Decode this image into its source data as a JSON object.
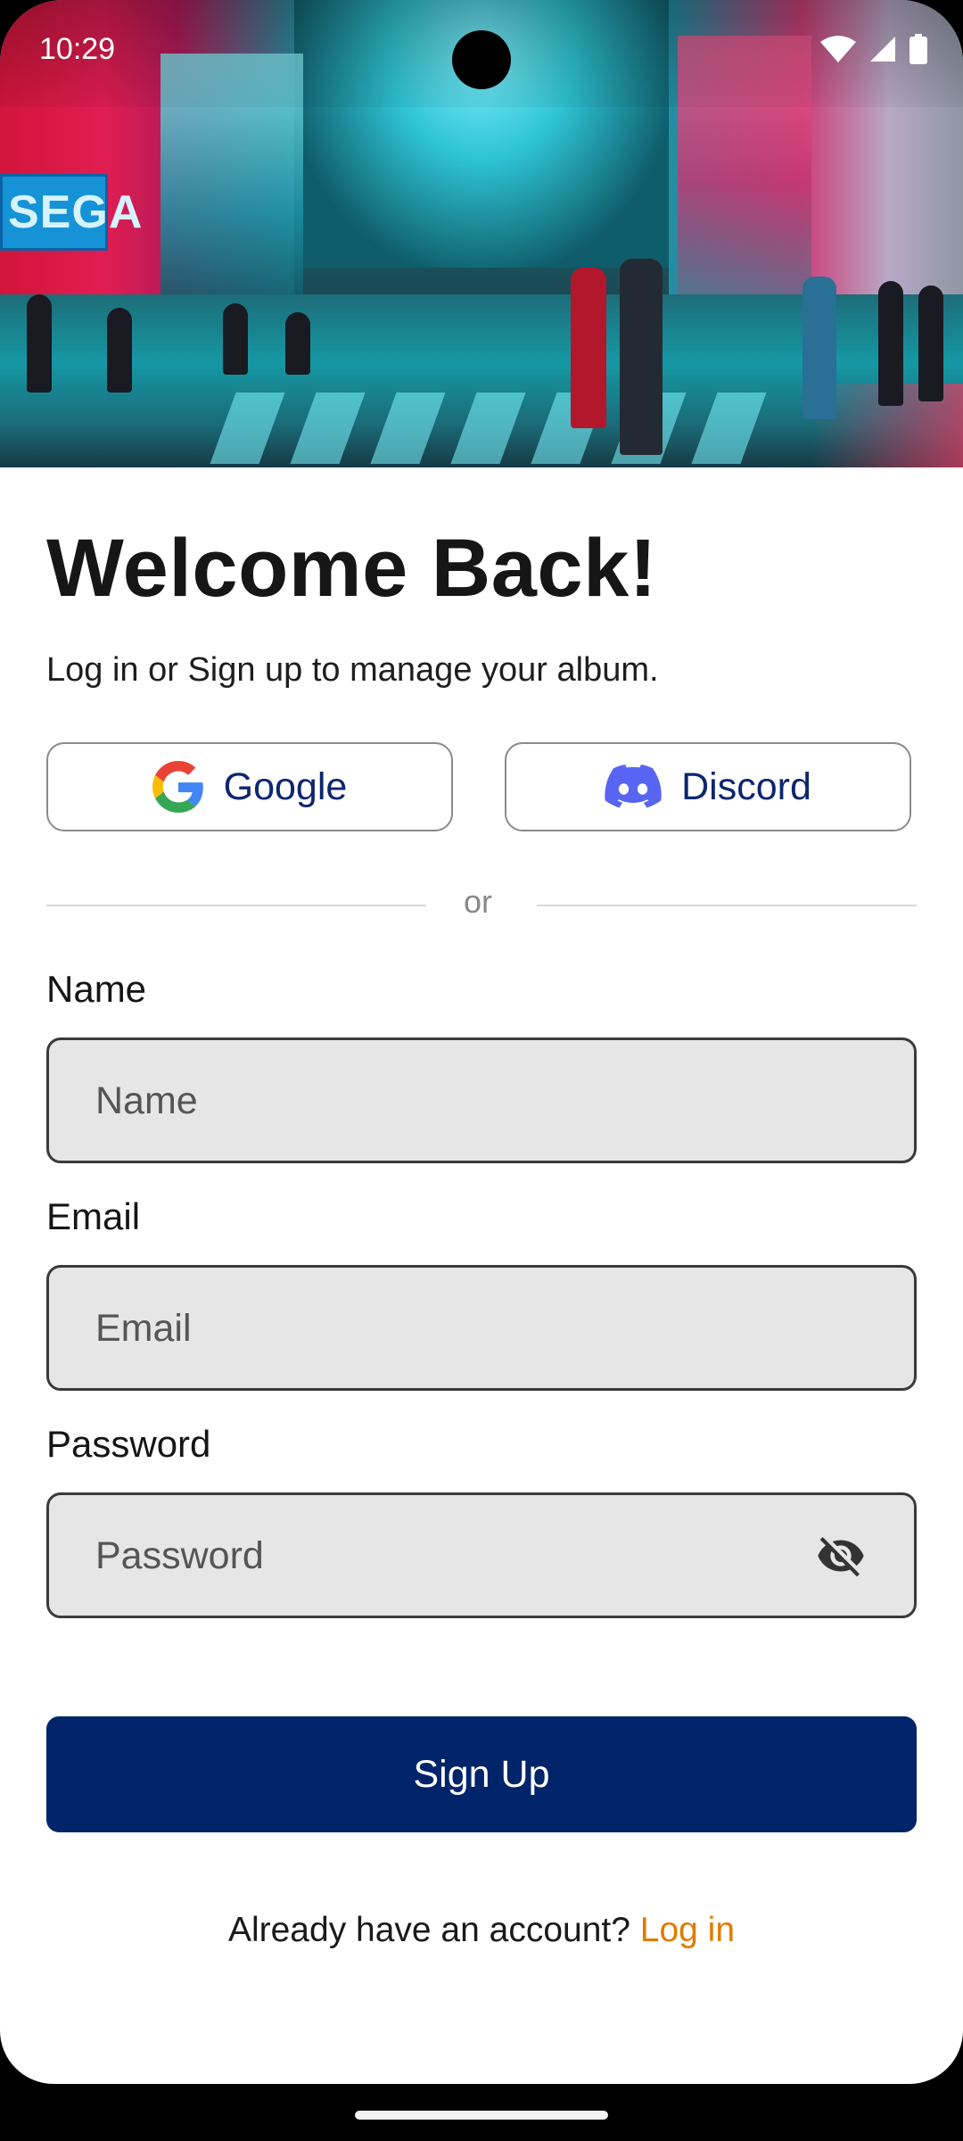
{
  "status_bar": {
    "time": "10:29"
  },
  "hero": {
    "sign_text": "SEGA"
  },
  "header": {
    "title": "Welcome Back!",
    "subtitle": "Log in or Sign up to manage your album."
  },
  "social": {
    "google_label": "Google",
    "discord_label": "Discord"
  },
  "divider": {
    "text": "or"
  },
  "form": {
    "name_label": "Name",
    "name_placeholder": "Name",
    "email_label": "Email",
    "email_placeholder": "Email",
    "password_label": "Password",
    "password_placeholder": "Password"
  },
  "actions": {
    "signup_label": "Sign Up"
  },
  "footer": {
    "prompt": "Already have an account? ",
    "login_link": "Log in"
  },
  "colors": {
    "primary": "#00246a",
    "link": "#e07b00",
    "field_bg": "#e6e6e6",
    "social_text": "#0d2670"
  }
}
